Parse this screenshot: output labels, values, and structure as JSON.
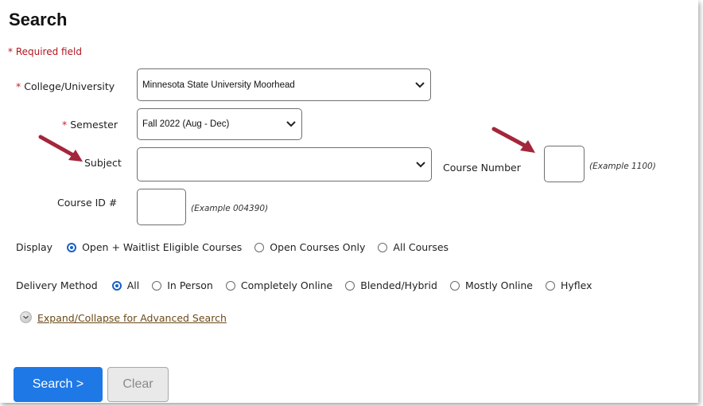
{
  "page_title": "Search",
  "required_note": "* Required field",
  "required_marker": "*",
  "fields": {
    "college": {
      "label": "College/University",
      "value": "Minnesota State University Moorhead"
    },
    "semester": {
      "label": "Semester",
      "value": "Fall 2022 (Aug - Dec)"
    },
    "subject": {
      "label": "Subject",
      "value": ""
    },
    "course_number": {
      "label": "Course Number",
      "value": "",
      "example": "(Example 1100)"
    },
    "course_id": {
      "label": "Course ID #",
      "value": "",
      "example": "(Example 004390)"
    }
  },
  "display": {
    "label": "Display",
    "options": [
      "Open + Waitlist Eligible Courses",
      "Open Courses Only",
      "All Courses"
    ],
    "selected": "Open + Waitlist Eligible Courses"
  },
  "delivery": {
    "label": "Delivery Method",
    "options": [
      "All",
      "In Person",
      "Completely Online",
      "Blended/Hybrid",
      "Mostly Online",
      "Hyflex"
    ],
    "selected": "All"
  },
  "advanced_link": "Expand/Collapse for Advanced Search",
  "buttons": {
    "search": "Search >",
    "clear": "Clear"
  },
  "colors": {
    "required": "#c0262d",
    "primary_button": "#1e78e6",
    "radio_selected": "#1a5fc7",
    "annotation_arrow": "#a3263a",
    "link": "#6b4a1a"
  },
  "icons": {
    "select_arrow": "chevron-down-icon",
    "expand": "expand-circle-icon",
    "annotation": "arrow-icon"
  }
}
